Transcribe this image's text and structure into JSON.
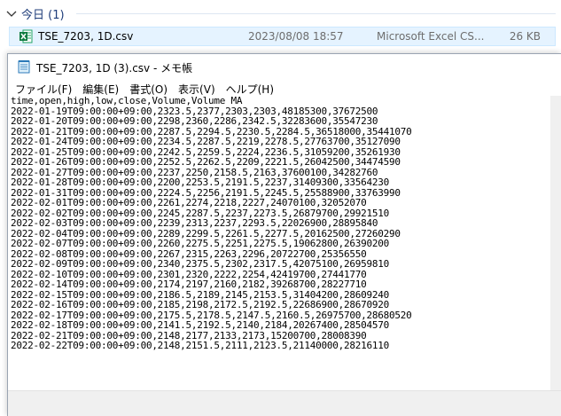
{
  "explorer": {
    "group_title": "今日 (1)",
    "file": {
      "name": "TSE_7203, 1D.csv",
      "date": "2023/08/08 18:57",
      "type": "Microsoft Excel CS...",
      "size": "26 KB"
    }
  },
  "notepad": {
    "title": "TSE_7203, 1D (3).csv - メモ帳",
    "menu": [
      "ファイル(F)",
      "編集(E)",
      "書式(O)",
      "表示(V)",
      "ヘルプ(H)"
    ],
    "lines": [
      "time,open,high,low,close,Volume,Volume MA",
      "2022-01-19T09:00:00+09:00,2323.5,2377,2303,2303,48185300,37672500",
      "2022-01-20T09:00:00+09:00,2298,2360,2286,2342.5,32283600,35547230",
      "2022-01-21T09:00:00+09:00,2287.5,2294.5,2230.5,2284.5,36518000,35441070",
      "2022-01-24T09:00:00+09:00,2234.5,2287.5,2219,2278.5,27763700,35127090",
      "2022-01-25T09:00:00+09:00,2242.5,2259.5,2224,2236.5,31059200,35261930",
      "2022-01-26T09:00:00+09:00,2252.5,2262.5,2209,2221.5,26042500,34474590",
      "2022-01-27T09:00:00+09:00,2237,2250,2158.5,2163,37600100,34282760",
      "2022-01-28T09:00:00+09:00,2200,2253.5,2191.5,2237,31409300,33564230",
      "2022-01-31T09:00:00+09:00,2224.5,2256,2191.5,2245.5,25588900,33763990",
      "2022-02-01T09:00:00+09:00,2261,2274,2218,2227,24070100,32052070",
      "2022-02-02T09:00:00+09:00,2245,2287.5,2237,2273.5,26879700,29921510",
      "2022-02-03T09:00:00+09:00,2239,2313,2237,2293.5,22026900,28895840",
      "2022-02-04T09:00:00+09:00,2289,2299.5,2261.5,2277.5,20162500,27260290",
      "2022-02-07T09:00:00+09:00,2260,2275.5,2251,2275.5,19062800,26390200",
      "2022-02-08T09:00:00+09:00,2267,2315,2263,2296,20722700,25356550",
      "2022-02-09T09:00:00+09:00,2340,2375.5,2302,2317.5,42075100,26959810",
      "2022-02-10T09:00:00+09:00,2301,2320,2222,2254,42419700,27441770",
      "2022-02-14T09:00:00+09:00,2174,2197,2160,2182,39268700,28227710",
      "2022-02-15T09:00:00+09:00,2186.5,2189,2145,2153.5,31404200,28609240",
      "2022-02-16T09:00:00+09:00,2185,2198,2172.5,2192.5,22686900,28670920",
      "2022-02-17T09:00:00+09:00,2175.5,2178.5,2147.5,2160.5,26975700,28680520",
      "2022-02-18T09:00:00+09:00,2141.5,2192.5,2140,2184,20267400,28504570",
      "2022-02-21T09:00:00+09:00,2148,2177,2133,2173,15200700,28008390",
      "2022-02-22T09:00:00+09:00,2148,2151.5,2111,2123.5,21140000,28216110"
    ]
  }
}
